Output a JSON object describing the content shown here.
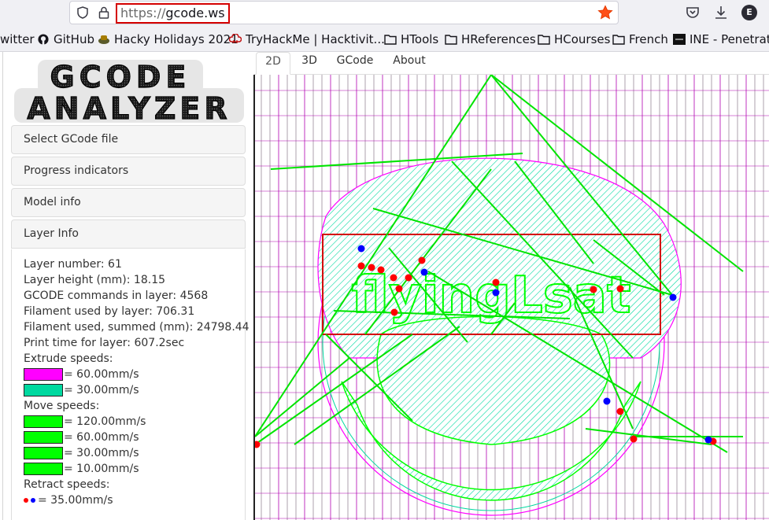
{
  "browser": {
    "url_scheme": "https://",
    "url_host": "gcode.ws",
    "profile_initial": "E",
    "bookmarks": [
      {
        "label": "witter",
        "icon": "none"
      },
      {
        "label": "GitHub",
        "icon": "github-icon"
      },
      {
        "label": "Hacky Holidays 2021",
        "icon": "hacky-holidays-icon"
      },
      {
        "label": "TryHackMe | Hacktivit...",
        "icon": "tryhackme-icon"
      },
      {
        "label": "HTools",
        "icon": "folder-icon"
      },
      {
        "label": "HReferences",
        "icon": "folder-icon"
      },
      {
        "label": "HCourses",
        "icon": "folder-icon"
      },
      {
        "label": "French",
        "icon": "folder-icon"
      },
      {
        "label": "INE - Penetration",
        "icon": "ine-icon"
      }
    ]
  },
  "app": {
    "logo_line1": "GCODE",
    "logo_line2": "ANALYZER",
    "panels": {
      "select_gcode": "Select GCode file",
      "progress": "Progress indicators",
      "model_info": "Model info",
      "layer_info": "Layer Info"
    },
    "layer_info": {
      "layer_number": "Layer number: 61",
      "layer_height": "Layer height (mm): 18.15",
      "gcode_commands": "GCODE commands in layer: 4568",
      "filament_layer": "Filament used by layer: 706.31",
      "filament_summed": "Filament used, summed (mm): 24798.44",
      "print_time": "Print time for layer: 607.2sec",
      "extrude_title": "Extrude speeds:",
      "extrude_1": "= 60.00mm/s",
      "extrude_2": "= 30.00mm/s",
      "move_title": "Move speeds:",
      "move_1": "= 120.00mm/s",
      "move_2": "= 60.00mm/s",
      "move_3": "= 30.00mm/s",
      "move_4": "= 10.00mm/s",
      "retract_title": "Retract speeds:",
      "retract_1": "= 35.00mm/s"
    },
    "colors": {
      "extrude_60": "#ff00ff",
      "extrude_30": "#00d9a0",
      "move": "#00ff00",
      "retract_red": "#ff0000",
      "retract_blue": "#0000ff"
    },
    "tabs": [
      "2D",
      "3D",
      "GCode",
      "About"
    ],
    "active_tab": "2D",
    "render_text": "flyingLsat"
  }
}
